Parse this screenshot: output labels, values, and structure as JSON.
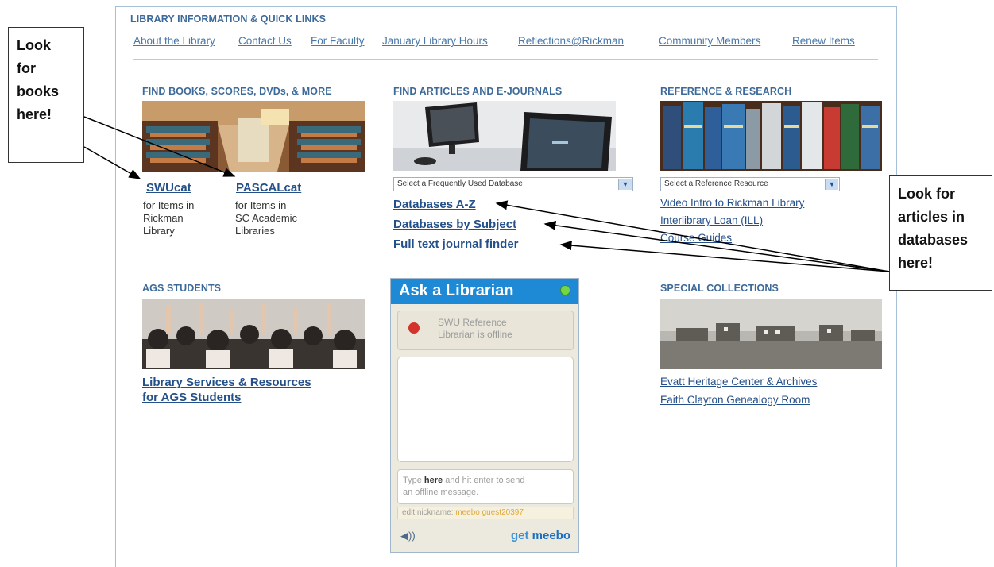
{
  "header": {
    "title": "LIBRARY INFORMATION & QUICK LINKS",
    "links": [
      "About the Library",
      "Contact Us",
      "For Faculty",
      "January Library Hours",
      "Reflections@Rickman",
      "Community Members",
      "Renew Items"
    ]
  },
  "books": {
    "heading": "FIND BOOKS, SCORES, DVDs, & MORE",
    "swucat": {
      "label": "SWUcat",
      "desc": [
        "for Items in",
        "Rickman",
        "Library"
      ]
    },
    "pascalcat": {
      "label": "PASCALcat",
      "desc": [
        "for Items in",
        "SC Academic",
        "Libraries"
      ]
    }
  },
  "articles": {
    "heading": "FIND ARTICLES AND E-JOURNALS",
    "select_value": "Select a Frequently Used Database",
    "links": [
      "Databases A-Z",
      "Databases by Subject",
      "Full text journal finder"
    ]
  },
  "reference": {
    "heading": "REFERENCE & RESEARCH",
    "select_value": "Select a Reference Resource",
    "links": [
      "Video Intro to Rickman Library",
      "Interlibrary Loan (ILL)",
      "Course Guides"
    ]
  },
  "ags": {
    "heading": "AGS STUDENTS",
    "link_lines": [
      "Library Services & Resources",
      "for AGS Students"
    ]
  },
  "ask": {
    "title": "Ask a Librarian",
    "status": [
      "SWU Reference",
      "Librarian is offline"
    ],
    "input_pre": "Type ",
    "input_bold": "here",
    "input_post": " and hit enter to send",
    "input_line2": "an offline message.",
    "nick_label": "edit nickname: ",
    "nick_value": "meebo guest20397",
    "brand_pre": "get ",
    "brand": "meebo"
  },
  "special": {
    "heading": "SPECIAL COLLECTIONS",
    "links": [
      "Evatt Heritage Center & Archives",
      "Faith Clayton Genealogy Room"
    ]
  },
  "callouts": {
    "books": [
      "Look",
      "for",
      "books",
      "here!"
    ],
    "articles": [
      "Look for",
      "articles in",
      "databases",
      "here!"
    ]
  }
}
